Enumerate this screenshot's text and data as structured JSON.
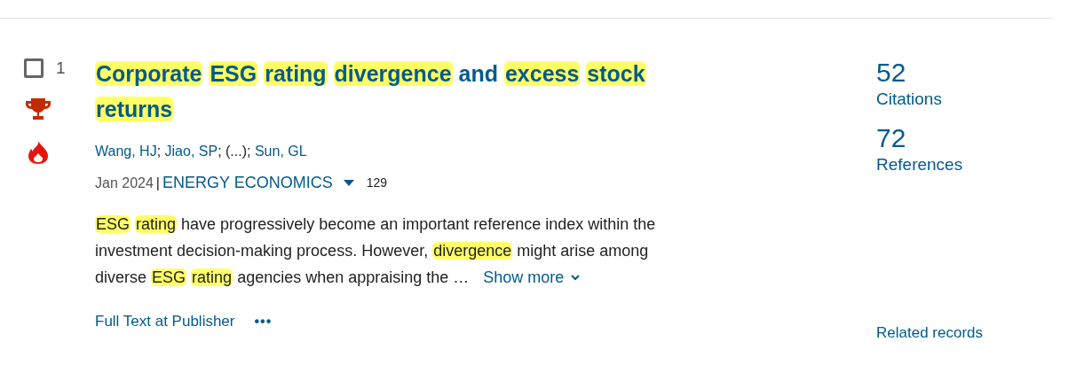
{
  "record": {
    "index": "1",
    "selected": false,
    "badges": [
      {
        "kind": "trophy"
      },
      {
        "kind": "flame"
      }
    ],
    "title": [
      {
        "text": "Corporate",
        "highlight": true
      },
      {
        "text": "ESG",
        "highlight": true
      },
      {
        "text": "rating",
        "highlight": true
      },
      {
        "text": "divergence",
        "highlight": true
      },
      {
        "text": "and",
        "highlight": false
      },
      {
        "text": "excess",
        "highlight": true
      },
      {
        "text": "stock",
        "highlight": true
      },
      {
        "text": "returns",
        "highlight": true
      }
    ],
    "authors": [
      {
        "text": "Wang, HJ",
        "link": true
      },
      {
        "text": "; ",
        "link": false
      },
      {
        "text": "Jiao, SP",
        "link": true
      },
      {
        "text": "; (...); ",
        "link": false
      },
      {
        "text": "Sun, GL",
        "link": true
      }
    ],
    "date": "Jan 2024",
    "separator": "|",
    "journal": "ENERGY ECONOMICS",
    "journal_count": "129",
    "abstract": [
      [
        {
          "text": "ESG",
          "highlight": true
        },
        {
          "text": "rating",
          "highlight": true
        },
        {
          "text": "have progressively become an important reference index within the",
          "highlight": false
        }
      ],
      [
        {
          "text": "investment decision-making process. However,",
          "highlight": false
        },
        {
          "text": "divergence",
          "highlight": true
        },
        {
          "text": "might arise among",
          "highlight": false
        }
      ],
      [
        {
          "text": "diverse",
          "highlight": false
        },
        {
          "text": "ESG",
          "highlight": true
        },
        {
          "text": "rating",
          "highlight": true
        },
        {
          "text": "agencies when appraising the …",
          "highlight": false
        }
      ]
    ],
    "show_more": "Show more",
    "full_text_link": "Full Text at Publisher",
    "more_button": "•••",
    "citations": {
      "count": "52",
      "label": "Citations"
    },
    "references": {
      "count": "72",
      "label": "References"
    },
    "related": "Related records"
  }
}
